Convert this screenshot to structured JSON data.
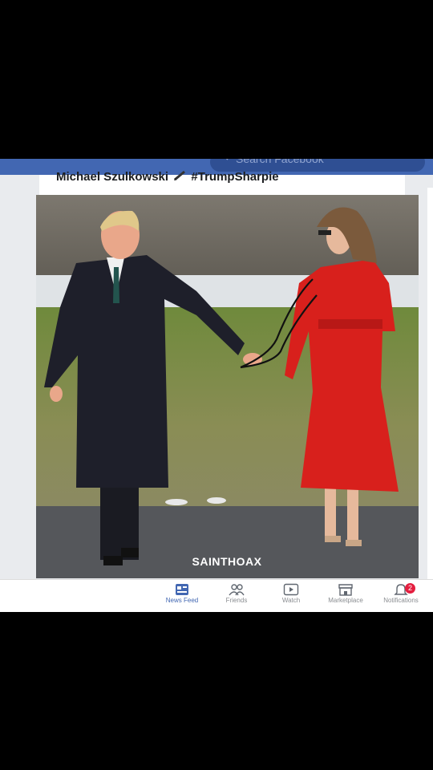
{
  "header": {
    "search_placeholder": "Search Facebook"
  },
  "post": {
    "author": "Michael Szulkowski",
    "caption": "#TrumpSharpie"
  },
  "photo": {
    "watermark": "SAINTHOAX"
  },
  "nav": {
    "items": [
      {
        "label": "News Feed",
        "icon": "news-feed-icon",
        "active": true
      },
      {
        "label": "Friends",
        "icon": "friends-icon"
      },
      {
        "label": "Watch",
        "icon": "watch-icon"
      },
      {
        "label": "Marketplace",
        "icon": "marketplace-icon"
      },
      {
        "label": "Notifications",
        "icon": "bell-icon",
        "badge": "2"
      }
    ]
  },
  "colors": {
    "brand": "#4267b2",
    "badge": "#e41e3f",
    "coat_red": "#d8201c"
  }
}
